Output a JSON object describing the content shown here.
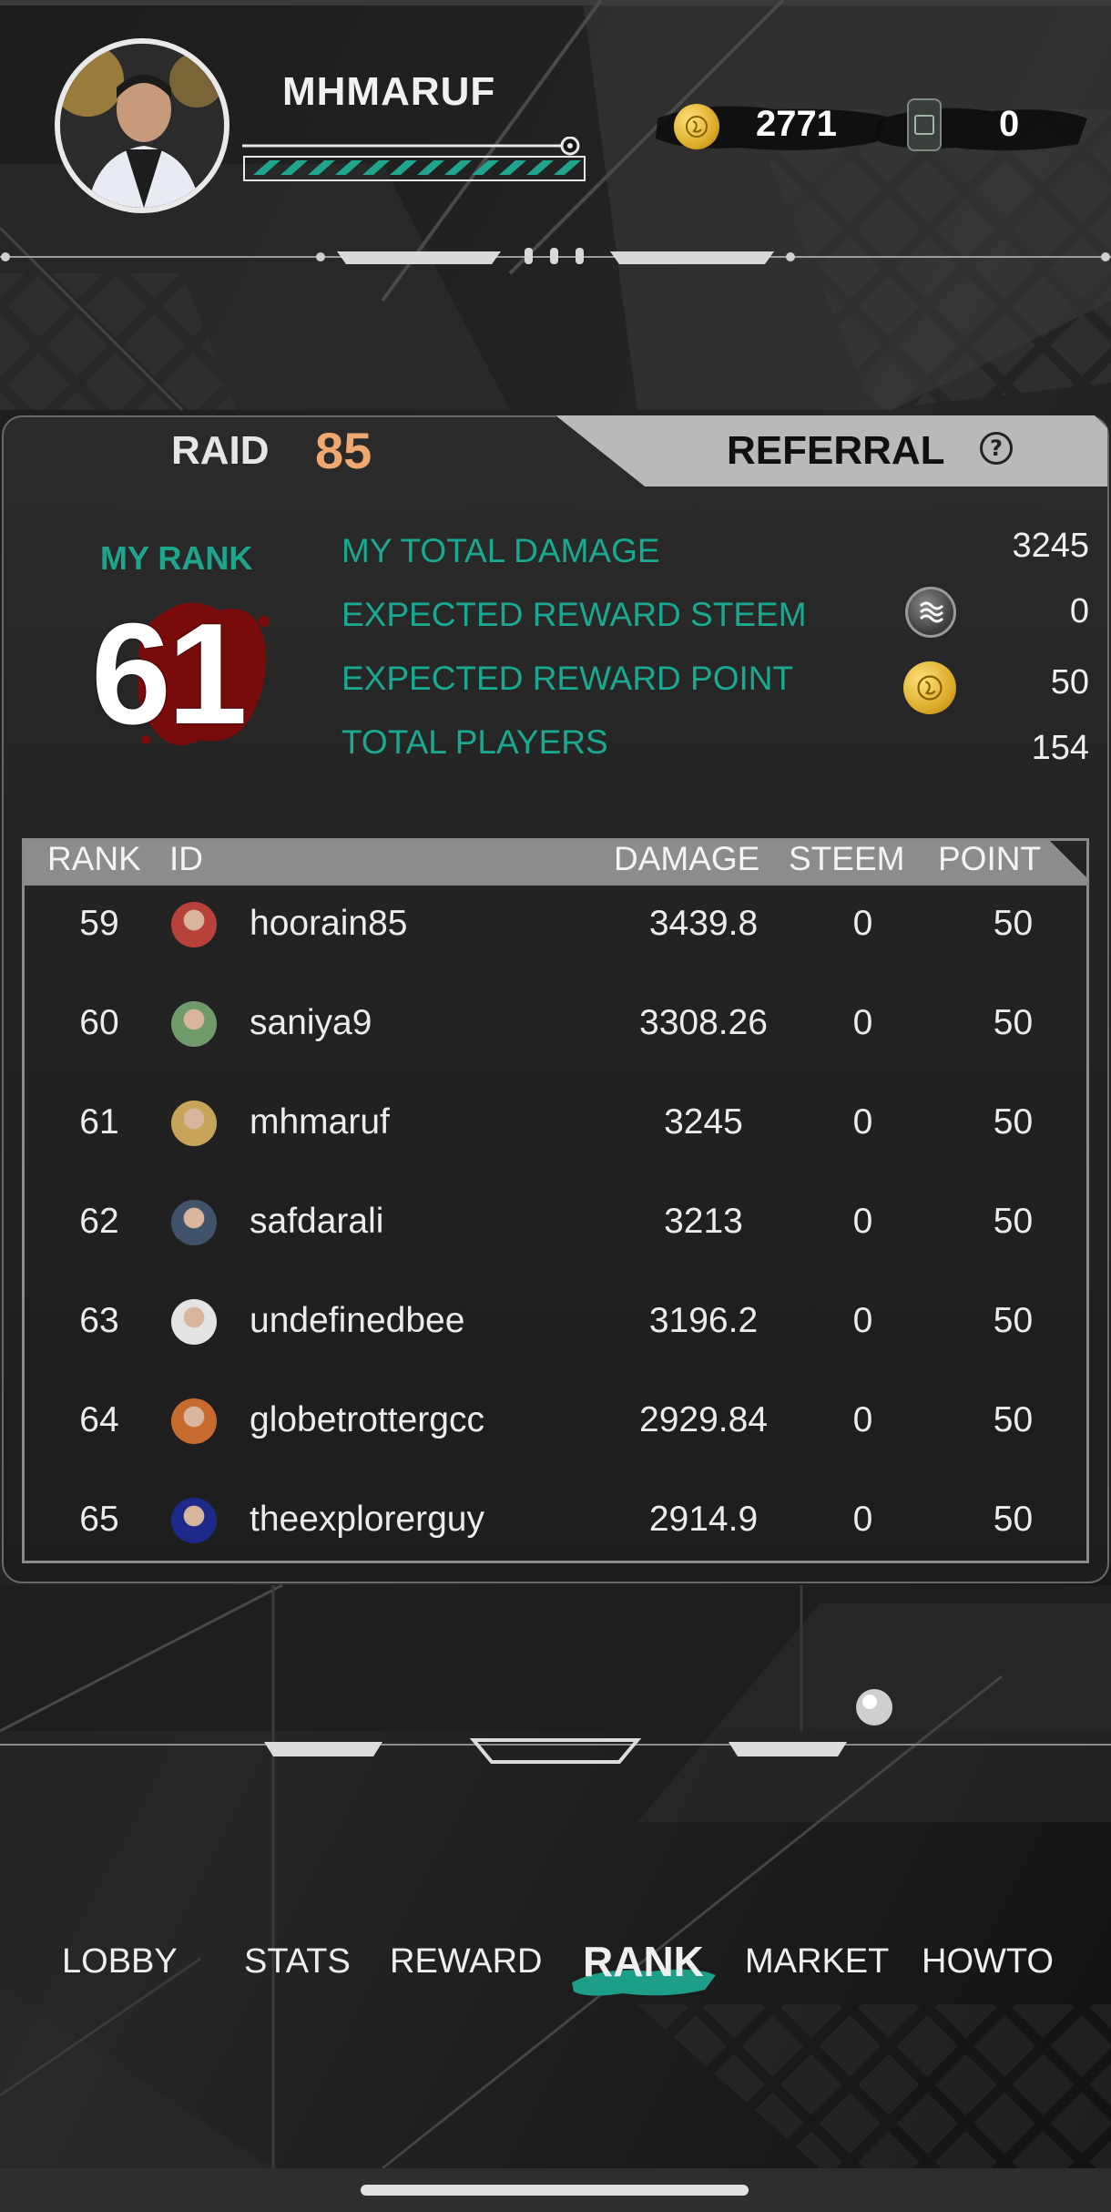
{
  "header": {
    "username": "MHMARUF",
    "coins": "2771",
    "tickets": "0",
    "icons": [
      "coin-icon",
      "ticket-icon"
    ]
  },
  "tabs": {
    "raid_label": "RAID",
    "raid_count": "85",
    "referral_label": "REFERRAL",
    "help_symbol": "?"
  },
  "summary": {
    "my_rank_label": "MY RANK",
    "my_rank_value": "61",
    "stats": [
      {
        "label": "MY TOTAL DAMAGE",
        "value": "3245"
      },
      {
        "label": "EXPECTED REWARD STEEM",
        "value": "0",
        "icon": "steem-icon"
      },
      {
        "label": "EXPECTED REWARD POINT",
        "value": "50",
        "icon": "coin-icon"
      },
      {
        "label": "TOTAL PLAYERS",
        "value": "154"
      }
    ]
  },
  "table": {
    "headers": [
      "RANK",
      "ID",
      "DAMAGE",
      "STEEM",
      "POINT"
    ],
    "rows": [
      {
        "rank": "59",
        "id": "hoorain85",
        "damage": "3439.8",
        "steem": "0",
        "point": "50",
        "avatar": "#b8423a"
      },
      {
        "rank": "60",
        "id": "saniya9",
        "damage": "3308.26",
        "steem": "0",
        "point": "50",
        "avatar": "#6f9a6a"
      },
      {
        "rank": "61",
        "id": "mhmaruf",
        "damage": "3245",
        "steem": "0",
        "point": "50",
        "avatar": "#c7a458"
      },
      {
        "rank": "62",
        "id": "safdarali",
        "damage": "3213",
        "steem": "0",
        "point": "50",
        "avatar": "#40536a"
      },
      {
        "rank": "63",
        "id": "undefinedbee",
        "damage": "3196.2",
        "steem": "0",
        "point": "50",
        "avatar": "#e4e4e4"
      },
      {
        "rank": "64",
        "id": "globetrottergcc",
        "damage": "2929.84",
        "steem": "0",
        "point": "50",
        "avatar": "#c76a2e"
      },
      {
        "rank": "65",
        "id": "theexplorerguy",
        "damage": "2914.9",
        "steem": "0",
        "point": "50",
        "avatar": "#1d2a8a"
      }
    ]
  },
  "nav": {
    "items": [
      "LOBBY",
      "STATS",
      "REWARD",
      "RANK",
      "MARKET",
      "HOWTO"
    ],
    "active": "RANK"
  },
  "colors": {
    "accent_teal": "#19a892",
    "raid_orange": "#f0a870",
    "rank_blood": "#7a0b0b"
  }
}
